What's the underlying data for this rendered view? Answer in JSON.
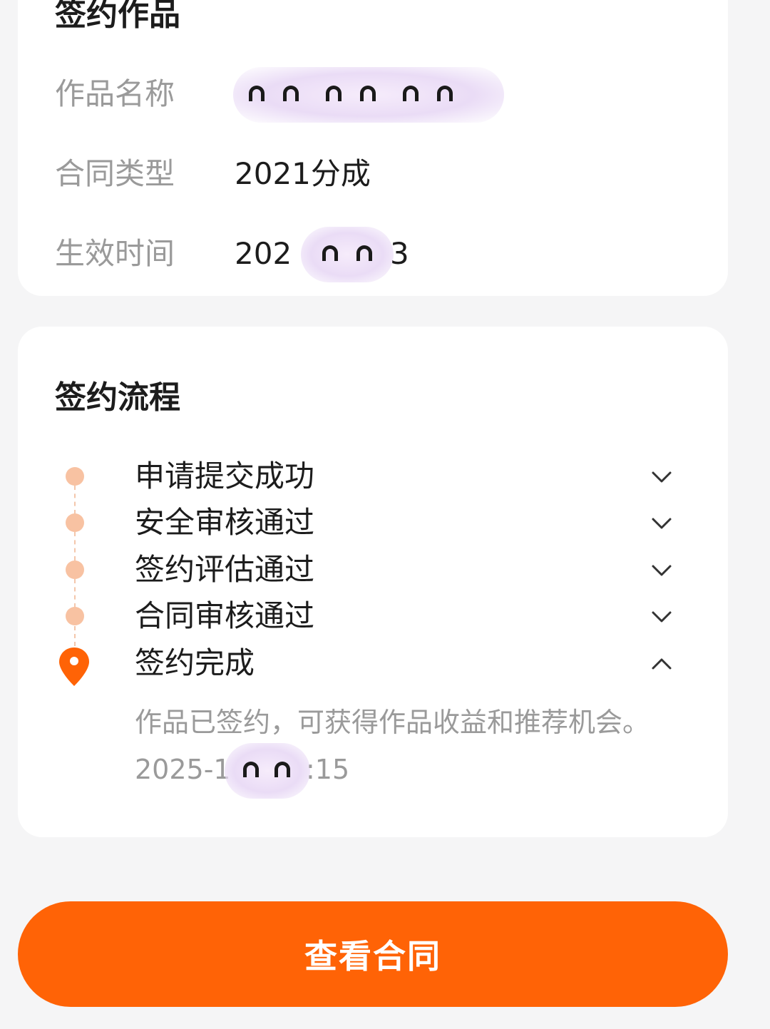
{
  "works_card": {
    "title": "签约作品",
    "rows": [
      {
        "label": "作品名称",
        "value": ""
      },
      {
        "label": "合同类型",
        "value": "2021分成"
      },
      {
        "label": "生效时间",
        "value_prefix": "202",
        "value_suffix": "3"
      }
    ]
  },
  "process_card": {
    "title": "签约流程",
    "steps": [
      {
        "label": "申请提交成功",
        "expanded": false
      },
      {
        "label": "安全审核通过",
        "expanded": false
      },
      {
        "label": "签约评估通过",
        "expanded": false
      },
      {
        "label": "合同审核通过",
        "expanded": false
      },
      {
        "label": "签约完成",
        "expanded": true
      }
    ],
    "final_description": "作品已签约，可获得作品收益和推荐机会。",
    "final_time_prefix": "2025-1",
    "final_time_suffix": ":15"
  },
  "actions": {
    "view_contract_label": "查看合同"
  },
  "colors": {
    "accent": "#ff6306",
    "step_dot": "#f8c2a2",
    "label_gray": "#9a9a9a",
    "text_dark": "#1c1c1c",
    "background": "#f5f5f6"
  },
  "icons": {
    "chevron_down": "chevron-down-icon",
    "chevron_up": "chevron-up-icon",
    "location_pin": "location-pin-icon"
  }
}
